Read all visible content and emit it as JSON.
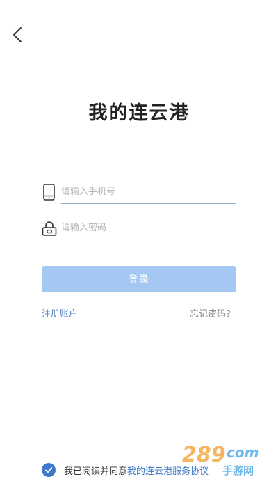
{
  "header": {
    "back_icon": "chevron-left-icon"
  },
  "app": {
    "title": "我的连云港"
  },
  "login_form": {
    "phone": {
      "placeholder": "请输入手机号",
      "value": "",
      "icon": "mobile-phone-icon"
    },
    "password": {
      "placeholder": "请输入密码",
      "value": "",
      "icon": "lock-icon"
    },
    "submit_label": "登录"
  },
  "links": {
    "register": "注册账户",
    "forgot_password": "忘记密码？"
  },
  "agreement": {
    "checked": true,
    "prefix": "我已阅读并同意",
    "link_text": "我的连云港服务协议"
  },
  "watermark": {
    "text": "289 手游网"
  },
  "colors": {
    "accent": "#3e79c9",
    "button_bg": "#a5c8f2",
    "link_gray": "#8a8a8a",
    "watermark_orange": "#f2a23a",
    "watermark_blue": "#3ea0e6"
  }
}
